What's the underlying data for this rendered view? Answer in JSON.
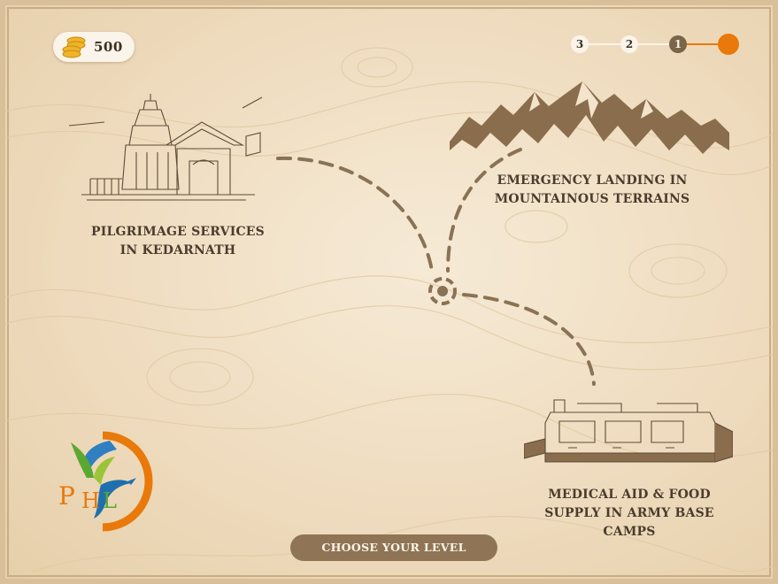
{
  "coins": {
    "count": "500",
    "icon": "coin-stack-icon"
  },
  "progress": {
    "steps": [
      {
        "label": "3",
        "state": "pending"
      },
      {
        "label": "2",
        "state": "pending"
      },
      {
        "label": "1",
        "state": "done"
      },
      {
        "label": "",
        "state": "current"
      }
    ],
    "accent_color": "#e8790a"
  },
  "levels": [
    {
      "line1": "PILGRIMAGE SERVICES",
      "line2": "IN KEDARNATH",
      "icon": "temple-icon"
    },
    {
      "line1": "EMERGENCY LANDING IN",
      "line2": "MOUNTAINOUS TERRAINS",
      "icon": "mountains-icon"
    },
    {
      "line1": "MEDICAL AID & FOOD",
      "line2": "SUPPLY IN ARMY BASE CAMPS",
      "icon": "army-camp-icon"
    }
  ],
  "cta": {
    "label": "CHOOSE YOUR LEVEL"
  },
  "logo": {
    "text": "PHL",
    "icon": "phl-bird-logo"
  },
  "colors": {
    "background": "#efdcbf",
    "ink": "#4b3c2e",
    "path": "#8a7255",
    "button": "#8f7555"
  }
}
